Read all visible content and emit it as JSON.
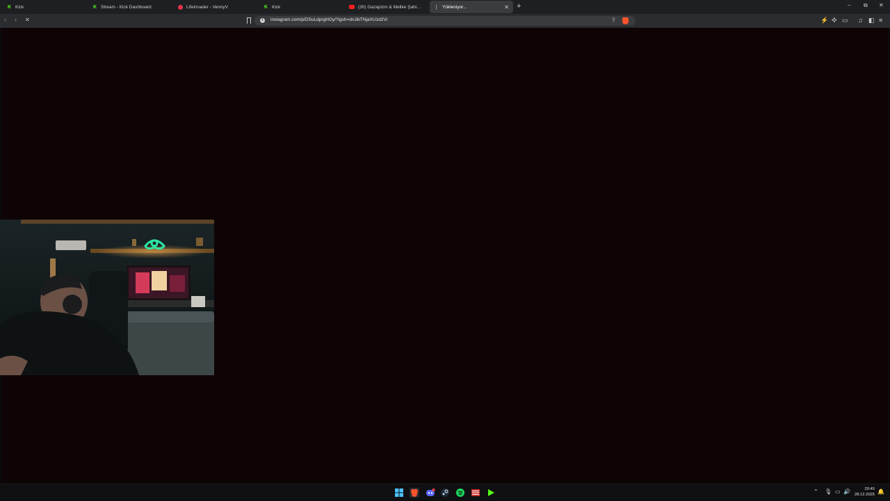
{
  "browser": {
    "tabs": [
      {
        "label": "Kick",
        "favicon": "kick-icon"
      },
      {
        "label": "Stream - Kick Dashboard",
        "favicon": "kick-icon"
      },
      {
        "label": "Lifeinvader - VennyV",
        "favicon": "lifeinvader-icon"
      },
      {
        "label": "Kick",
        "favicon": "kick-icon"
      },
      {
        "label": "(30) Gazapizm & Melike Şahin - Olu",
        "favicon": "youtube-icon"
      },
      {
        "label": "Yükleniyor...",
        "favicon": "loading-icon",
        "active": true
      }
    ],
    "url": "instagram.com/p/DSuLdprgHGy/?igsh=dnJibTNjaXU1d2Vi",
    "accent_color": "#fb542b"
  },
  "page": {
    "background": "#0e0406",
    "webcam": {
      "description_icon": "webcam-feed",
      "neon_sign_color": "#2ee6a6"
    }
  },
  "taskbar": {
    "apps": [
      "windows-start-icon",
      "brave-icon",
      "discord-icon",
      "steam-icon",
      "spotify-icon",
      "obs-icon",
      "kick-studio-icon"
    ],
    "clock": {
      "time": "20:45",
      "date": "28.12.2025"
    }
  }
}
